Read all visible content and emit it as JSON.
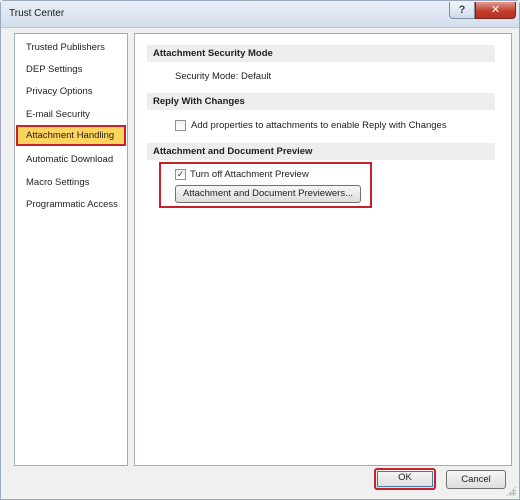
{
  "window": {
    "title": "Trust Center",
    "help_glyph": "?",
    "close_glyph": "✕"
  },
  "nav": {
    "items": [
      {
        "label": "Trusted Publishers"
      },
      {
        "label": "DEP Settings"
      },
      {
        "label": "Privacy Options"
      },
      {
        "label": "E-mail Security"
      },
      {
        "label": "Attachment Handling",
        "selected": true
      },
      {
        "label": "Automatic Download"
      },
      {
        "label": "Macro Settings"
      },
      {
        "label": "Programmatic Access"
      }
    ]
  },
  "main": {
    "attachment_security": {
      "header": "Attachment Security Mode",
      "mode_text": "Security Mode: Default"
    },
    "reply_with_changes": {
      "header": "Reply With Changes",
      "checkbox_label": "Add properties to attachments to enable Reply with Changes",
      "checked": false
    },
    "preview": {
      "header": "Attachment and Document Preview",
      "checkbox_label": "Turn off Attachment Preview",
      "checked": true,
      "check_glyph": "✓",
      "previewers_button": "Attachment and Document Previewers..."
    }
  },
  "footer": {
    "ok_label": "OK",
    "cancel_label": "Cancel"
  },
  "colors": {
    "selection": "#ffd45c",
    "highlight_border": "#c8202c",
    "section_header_bg": "#ededed"
  }
}
